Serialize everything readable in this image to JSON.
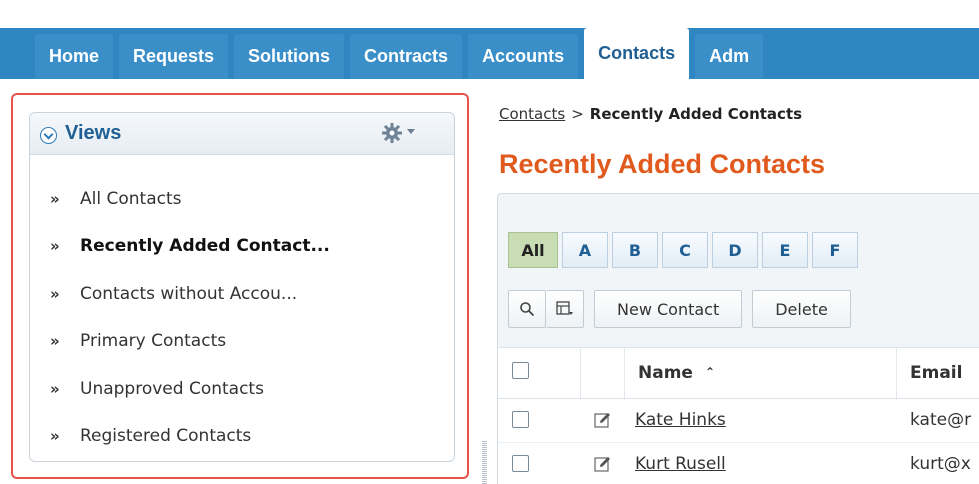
{
  "nav": {
    "tabs": [
      {
        "label": "Home"
      },
      {
        "label": "Requests"
      },
      {
        "label": "Solutions"
      },
      {
        "label": "Contracts"
      },
      {
        "label": "Accounts"
      },
      {
        "label": "Contacts"
      },
      {
        "label": "Adm"
      }
    ],
    "active_tab": "Contacts"
  },
  "views": {
    "title": "Views",
    "items": [
      {
        "label": "All Contacts"
      },
      {
        "label": "Recently Added Contact..."
      },
      {
        "label": "Contacts without Accou..."
      },
      {
        "label": "Primary Contacts"
      },
      {
        "label": "Unapproved Contacts"
      },
      {
        "label": "Registered Contacts"
      }
    ],
    "chevron": "»",
    "active_index": 1
  },
  "breadcrumb": {
    "parent": "Contacts",
    "separator": ">",
    "current": "Recently Added Contacts"
  },
  "page_title": "Recently Added Contacts",
  "alphabet": [
    "All",
    "A",
    "B",
    "C",
    "D",
    "E",
    "F"
  ],
  "toolbar": {
    "new_label": "New Contact",
    "delete_label": "Delete"
  },
  "grid": {
    "columns": {
      "name": "Name",
      "email": "Email"
    },
    "rows": [
      {
        "name": "Kate Hinks",
        "email": "kate@r"
      },
      {
        "name": "Kurt Rusell",
        "email": "kurt@x"
      }
    ]
  },
  "colors": {
    "tab_bg": "#3a8fc8",
    "tab_active_text": "#1f5f93",
    "title_orange": "#e05a1e",
    "highlight_border": "#e8534a",
    "alpha_active": "#c8ddb3"
  }
}
